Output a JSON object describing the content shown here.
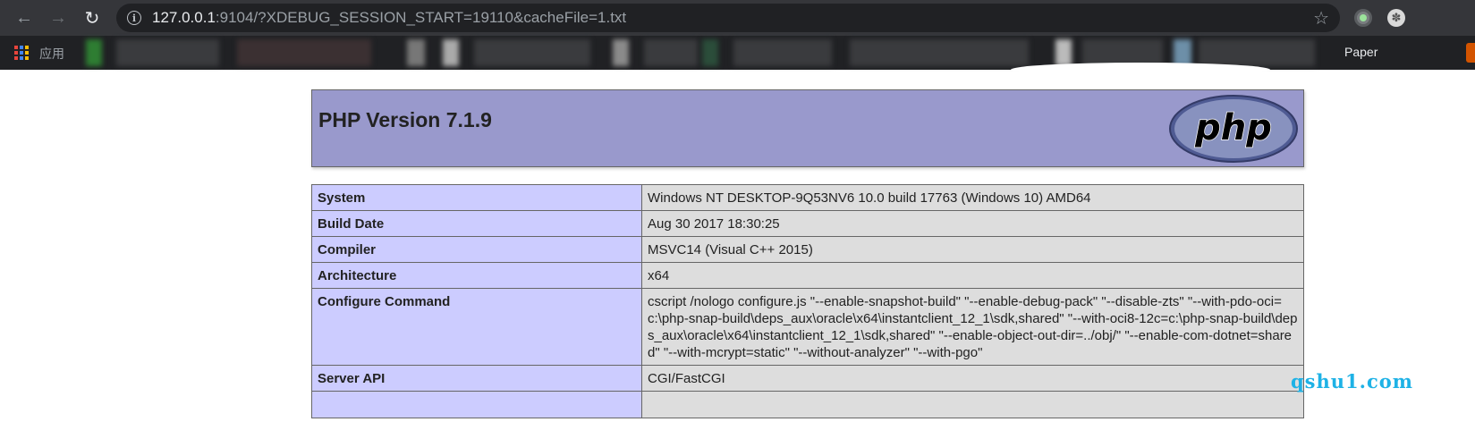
{
  "browser": {
    "url_host": "127.0.0.1",
    "url_rest": ":9104/?XDEBUG_SESSION_START=19110&cacheFile=1.txt",
    "bookmarks": {
      "apps_label": "应用",
      "paper_label": "Paper"
    },
    "icons": {
      "back": "arrow-left-icon",
      "forward": "arrow-right-icon",
      "reload": "reload-icon",
      "info": "info-icon",
      "star": "star-icon",
      "apps": "apps-grid-icon"
    }
  },
  "phpinfo": {
    "title": "PHP Version 7.1.9",
    "logo_text": "php",
    "rows": [
      {
        "key": "System",
        "value": "Windows NT DESKTOP-9Q53NV6 10.0 build 17763 (Windows 10) AMD64"
      },
      {
        "key": "Build Date",
        "value": "Aug 30 2017 18:30:25"
      },
      {
        "key": "Compiler",
        "value": "MSVC14 (Visual C++ 2015)"
      },
      {
        "key": "Architecture",
        "value": "x64"
      },
      {
        "key": "Configure Command",
        "value": "cscript /nologo configure.js \"--enable-snapshot-build\" \"--enable-debug-pack\" \"--disable-zts\" \"--with-pdo-oci=c:\\php-snap-build\\deps_aux\\oracle\\x64\\instantclient_12_1\\sdk,shared\" \"--with-oci8-12c=c:\\php-snap-build\\deps_aux\\oracle\\x64\\instantclient_12_1\\sdk,shared\" \"--enable-object-out-dir=../obj/\" \"--enable-com-dotnet=shared\" \"--with-mcrypt=static\" \"--without-analyzer\" \"--with-pgo\""
      },
      {
        "key": "Server API",
        "value": "CGI/FastCGI"
      },
      {
        "key": "",
        "value": ""
      }
    ],
    "colors": {
      "header_bg": "#9999cc",
      "key_bg": "#ccccff",
      "value_bg": "#dddddd"
    }
  },
  "watermark": "qshu1.com"
}
